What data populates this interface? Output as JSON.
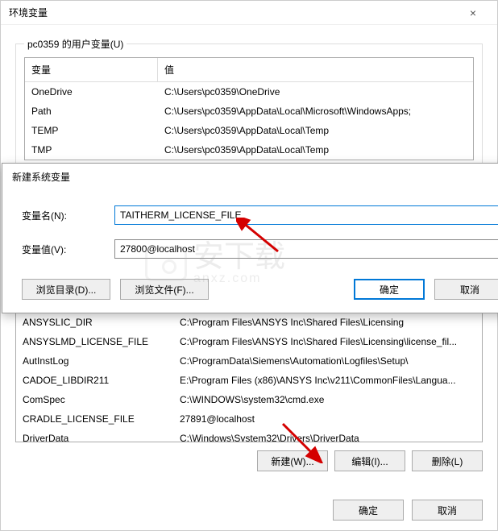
{
  "main_dialog": {
    "title": "环境变量",
    "close_icon": "×",
    "user_vars": {
      "legend": "pc0359 的用户变量(U)",
      "headers": {
        "name": "变量",
        "value": "值"
      },
      "rows": [
        {
          "name": "OneDrive",
          "value": "C:\\Users\\pc0359\\OneDrive"
        },
        {
          "name": "Path",
          "value": "C:\\Users\\pc0359\\AppData\\Local\\Microsoft\\WindowsApps;"
        },
        {
          "name": "TEMP",
          "value": "C:\\Users\\pc0359\\AppData\\Local\\Temp"
        },
        {
          "name": "TMP",
          "value": "C:\\Users\\pc0359\\AppData\\Local\\Temp"
        }
      ]
    },
    "system_vars": {
      "rows": [
        {
          "name": "ANSYSLIC_DIR",
          "value": "C:\\Program Files\\ANSYS Inc\\Shared Files\\Licensing"
        },
        {
          "name": "ANSYSLMD_LICENSE_FILE",
          "value": "C:\\Program Files\\ANSYS Inc\\Shared Files\\Licensing\\license_fil..."
        },
        {
          "name": "AutInstLog",
          "value": "C:\\ProgramData\\Siemens\\Automation\\Logfiles\\Setup\\"
        },
        {
          "name": "CADOE_LIBDIR211",
          "value": "E:\\Program Files (x86)\\ANSYS Inc\\v211\\CommonFiles\\Langua..."
        },
        {
          "name": "ComSpec",
          "value": "C:\\WINDOWS\\system32\\cmd.exe"
        },
        {
          "name": "CRADLE_LICENSE_FILE",
          "value": "27891@localhost"
        },
        {
          "name": "DriverData",
          "value": "C:\\Windows\\System32\\Drivers\\DriverData"
        }
      ],
      "btn_new": "新建(W)...",
      "btn_edit": "编辑(I)...",
      "btn_delete": "删除(L)"
    },
    "btn_ok": "确定",
    "btn_cancel": "取消"
  },
  "sub_dialog": {
    "title": "新建系统变量",
    "name_label": "变量名(N):",
    "name_value": "TAITHERM_LICENSE_FILE",
    "value_label": "变量值(V):",
    "value_value": "27800@localhost",
    "btn_browse_dir": "浏览目录(D)...",
    "btn_browse_file": "浏览文件(F)...",
    "btn_ok": "确定",
    "btn_cancel": "取消"
  },
  "watermark": {
    "main": "安下载",
    "sub": "anxz.com"
  }
}
